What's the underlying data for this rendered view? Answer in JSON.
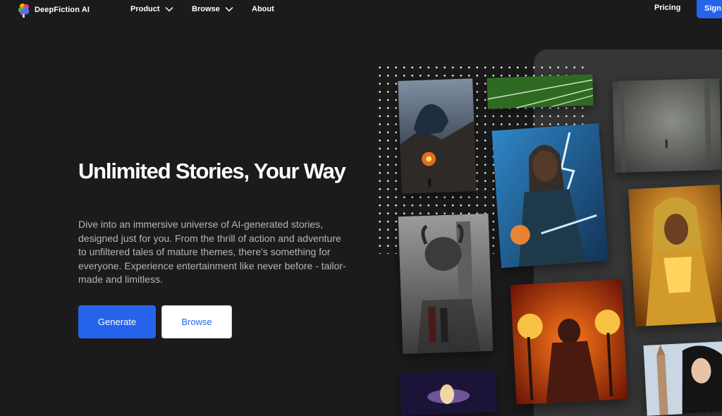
{
  "nav": {
    "brand": "DeepFiction AI",
    "links": [
      {
        "label": "Product",
        "has_dropdown": true
      },
      {
        "label": "Browse",
        "has_dropdown": true
      },
      {
        "label": "About",
        "has_dropdown": false
      }
    ],
    "pricing": "Pricing",
    "signin": "Sign"
  },
  "hero": {
    "title": "Unlimited Stories, Your Way",
    "description": "Dive into an immersive universe of AI-generated stories, designed just for you. From the thrill of action and adventure to unfiltered tales of mature themes, there's something for everyone. Experience entertainment like never before - tailor-made and limitless.",
    "primary_button": "Generate",
    "secondary_button": "Browse"
  },
  "colors": {
    "accent": "#2563eb",
    "background": "#1b1b1b",
    "panel": "#363636"
  },
  "gallery": [
    "dragon-on-cliff-image",
    "green-field-image",
    "foggy-forest-image",
    "sorceress-lightning-image",
    "golden-queen-image",
    "horned-beast-image",
    "fire-warrior-image",
    "galaxy-image",
    "woman-city-image"
  ]
}
